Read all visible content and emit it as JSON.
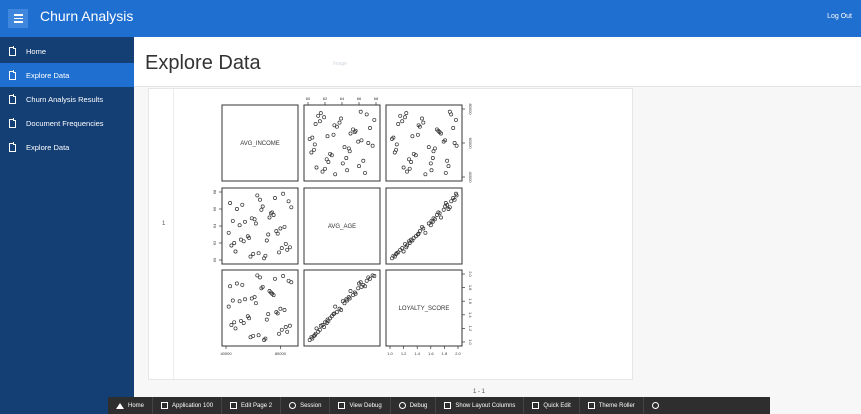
{
  "header": {
    "app_title": "Churn Analysis",
    "logout_label": "Log Out"
  },
  "sidebar": {
    "items": [
      {
        "label": "Home",
        "active": false
      },
      {
        "label": "Explore Data",
        "active": true
      },
      {
        "label": "Churn Analysis Results",
        "active": false
      },
      {
        "label": "Document Frequencies",
        "active": false
      },
      {
        "label": "Explore Data",
        "active": false
      }
    ]
  },
  "page": {
    "title": "Explore Data",
    "faint_label": "Image"
  },
  "report": {
    "row_number": "1",
    "pagination": "1 - 1"
  },
  "chart_data": {
    "type": "scatter",
    "variables": [
      "AVG_INCOME",
      "AVG_AGE",
      "LOYALTY_SCORE"
    ],
    "top_ticks": [
      "60",
      "62",
      "64",
      "66",
      "68"
    ],
    "right_ticks_top": [
      "40000",
      "60000",
      "80000"
    ],
    "left_ticks_middle": [
      "60",
      "62",
      "64",
      "66",
      "68"
    ],
    "right_ticks_bottom": [
      "1.0",
      "1.2",
      "1.4",
      "1.6",
      "1.8",
      "2.0"
    ],
    "bottom_ticks_left": [
      "40000",
      "80000"
    ],
    "bottom_ticks_right": [
      "1.0",
      "1.2",
      "1.4",
      "1.6",
      "1.8",
      "2.0"
    ],
    "points": {
      "avg_income": [
        42000,
        47000,
        52000,
        58000,
        61000,
        65000,
        70000,
        74000,
        79000,
        83000,
        88000,
        44000,
        50000,
        56000,
        63000,
        68000,
        72000,
        77000,
        81000,
        86000,
        46000,
        54000,
        60000,
        66000,
        71000,
        76000,
        84000,
        48000,
        57000,
        62000,
        69000,
        75000,
        80000,
        85000,
        43000,
        51000,
        59000,
        64000,
        73000,
        78000,
        82000,
        87000,
        45000,
        53000,
        67000
      ],
      "avg_age": [
        63.2,
        61.0,
        66.5,
        60.4,
        64.8,
        67.1,
        62.3,
        65.6,
        60.9,
        63.9,
        66.2,
        61.7,
        64.1,
        62.8,
        67.6,
        60.2,
        65.0,
        63.4,
        61.4,
        66.9,
        62.0,
        64.5,
        60.7,
        65.9,
        63.0,
        67.3,
        61.9,
        66.0,
        62.6,
        64.3,
        60.5,
        65.3,
        63.7,
        61.2,
        66.7,
        62.4,
        64.9,
        60.8,
        65.5,
        63.1,
        67.8,
        61.5,
        64.6,
        62.2,
        66.3
      ],
      "loyalty_score": [
        1.52,
        1.2,
        1.84,
        1.07,
        1.66,
        1.95,
        1.33,
        1.71,
        1.12,
        1.47,
        1.88,
        1.25,
        1.6,
        1.38,
        1.98,
        1.03,
        1.75,
        1.44,
        1.18,
        1.9,
        1.29,
        1.63,
        1.09,
        1.79,
        1.41,
        1.93,
        1.22,
        1.86,
        1.35,
        1.57,
        1.05,
        1.69,
        1.49,
        1.15,
        1.82,
        1.31,
        1.64,
        1.1,
        1.73,
        1.42,
        1.97,
        1.24,
        1.61,
        1.28,
        1.81
      ]
    },
    "ranges": {
      "avg_income": [
        40000,
        90000
      ],
      "avg_age": [
        60,
        68
      ],
      "loyalty_score": [
        1.0,
        2.0
      ]
    }
  },
  "dev_toolbar": {
    "items": [
      {
        "label": "Home",
        "icon": "home-icon"
      },
      {
        "label": "Application 100",
        "icon": "edit-app-icon"
      },
      {
        "label": "Edit Page 2",
        "icon": "edit-page-icon"
      },
      {
        "label": "Session",
        "icon": "session-icon"
      },
      {
        "label": "View Debug",
        "icon": "view-debug-icon"
      },
      {
        "label": "Debug",
        "icon": "debug-icon"
      },
      {
        "label": "Show Layout Columns",
        "icon": "grid-icon"
      },
      {
        "label": "Quick Edit",
        "icon": "quick-edit-icon"
      },
      {
        "label": "Theme Roller",
        "icon": "theme-roller-icon"
      },
      {
        "label": "",
        "icon": "gear-icon"
      }
    ]
  }
}
